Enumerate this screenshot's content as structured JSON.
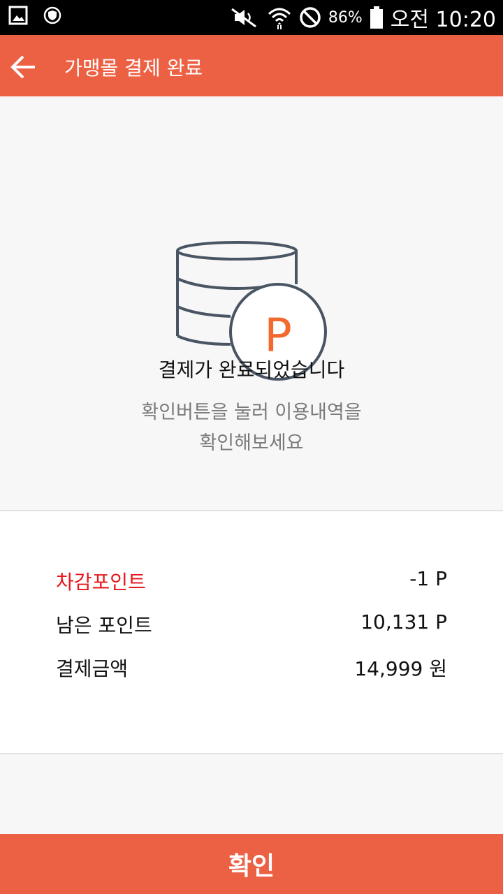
{
  "status_bar": {
    "battery": "86%",
    "time": "오전 10:20",
    "icons": [
      "gallery-icon",
      "shield-icon",
      "mute-icon",
      "wifi-icon",
      "block-icon",
      "battery-icon"
    ]
  },
  "app_bar": {
    "title": "가맹몰 결제 완료",
    "back_icon": "arrow-left-icon"
  },
  "hero": {
    "icon": "database-coin-p-icon",
    "coin_letter": "P",
    "title": "결제가 완료되었습니다",
    "subtitle_line1": "확인버튼을 눌러 이용내역을",
    "subtitle_line2": "확인해보세요"
  },
  "details": {
    "rows": [
      {
        "label": "차감포인트",
        "value": "-1 P"
      },
      {
        "label": "남은 포인트",
        "value": "10,131 P"
      },
      {
        "label": "결제금액",
        "value": "14,999 원"
      }
    ]
  },
  "confirm_button": {
    "label": "확인"
  },
  "colors": {
    "accent": "#ec6144",
    "highlight_label": "#e8151a",
    "coin_letter": "#f26a2e",
    "icon_stroke": "#4a5563"
  }
}
